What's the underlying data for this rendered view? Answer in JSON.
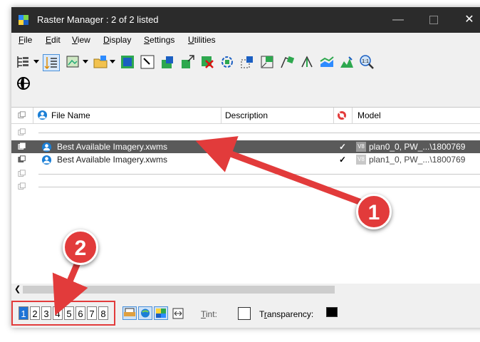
{
  "window": {
    "title": "Raster Manager : 2 of 2 listed"
  },
  "menu": [
    {
      "label": "File",
      "u": "F",
      "rest": "ile"
    },
    {
      "label": "Edit",
      "u": "E",
      "rest": "dit"
    },
    {
      "label": "View",
      "u": "V",
      "rest": "iew"
    },
    {
      "label": "Display",
      "u": "D",
      "rest": "isplay"
    },
    {
      "label": "Settings",
      "u": "S",
      "rest": "ettings"
    },
    {
      "label": "Utilities",
      "u": "U",
      "rest": "tilities"
    }
  ],
  "columns": {
    "file_name": "File Name",
    "description": "Description",
    "model": "Model"
  },
  "rows": [
    {
      "file": "Best Available Imagery.xwms",
      "check": "✓",
      "badge": "V8",
      "model": "plan0_0, PW_...\\1800769"
    },
    {
      "file": "Best Available Imagery.xwms",
      "check": "✓",
      "badge": "V8",
      "model": "plan1_0, PW_...\\1800769"
    }
  ],
  "view_buttons": [
    "1",
    "2",
    "3",
    "4",
    "5",
    "6",
    "7",
    "8"
  ],
  "active_view": "1",
  "status": {
    "tint_label": "Tint:",
    "tint_u": "T",
    "tint_rest": "int:",
    "transparency_label": "Transparency:",
    "transparency_pre": "T",
    "transparency_u": "r",
    "transparency_rest": "ansparency:"
  },
  "callouts": {
    "one": "1",
    "two": "2"
  },
  "colors": {
    "titlebar": "#2b2b2b",
    "selected_row": "#5a5a5a",
    "annotation_red": "#e23b3b",
    "active_view": "#1e73d6"
  }
}
